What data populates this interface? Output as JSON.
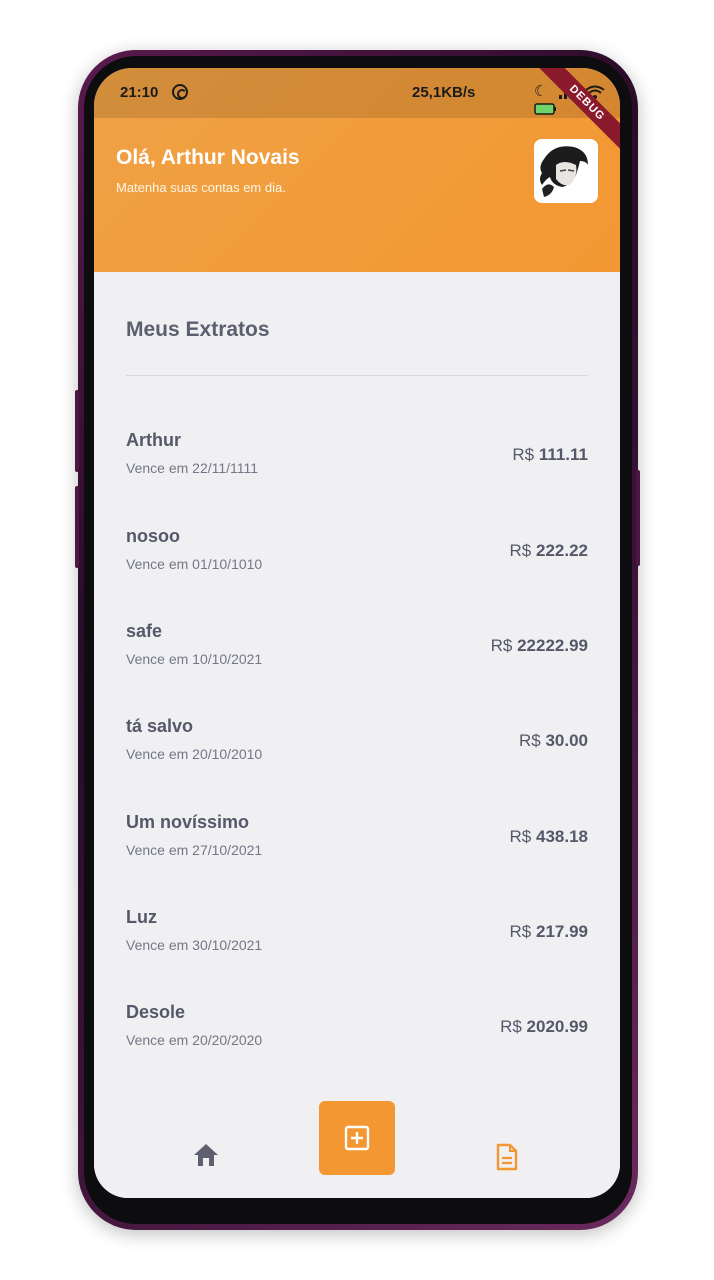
{
  "status_bar": {
    "time": "21:10",
    "speed": "25,1KB/s",
    "icons": [
      "moon-icon",
      "signal-icon",
      "wifi-icon",
      "battery-icon"
    ]
  },
  "debug_banner": "DEBUG",
  "header": {
    "greeting": "Olá, Arthur Novais",
    "subtitle": "Matenha suas contas em dia.",
    "accent_color": "#f29732"
  },
  "section": {
    "title": "Meus Extratos"
  },
  "currency": "R$",
  "bills": [
    {
      "name": "Arthur",
      "due": "Vence em 22/11/1111",
      "amount": "111.11"
    },
    {
      "name": "nosoo",
      "due": "Vence em 01/10/1010",
      "amount": "222.22"
    },
    {
      "name": "safe",
      "due": "Vence em 10/10/2021",
      "amount": "22222.99"
    },
    {
      "name": "tá salvo",
      "due": "Vence em 20/10/2010",
      "amount": "30.00"
    },
    {
      "name": "Um novíssimo",
      "due": "Vence em 27/10/2021",
      "amount": "438.18"
    },
    {
      "name": "Luz",
      "due": "Vence em 30/10/2021",
      "amount": "217.99"
    },
    {
      "name": "Desole",
      "due": "Vence em 20/20/2020",
      "amount": "2020.99"
    }
  ],
  "nav": {
    "items": [
      "home-icon",
      "add-box-icon",
      "document-icon"
    ],
    "active": "add-box-icon"
  }
}
